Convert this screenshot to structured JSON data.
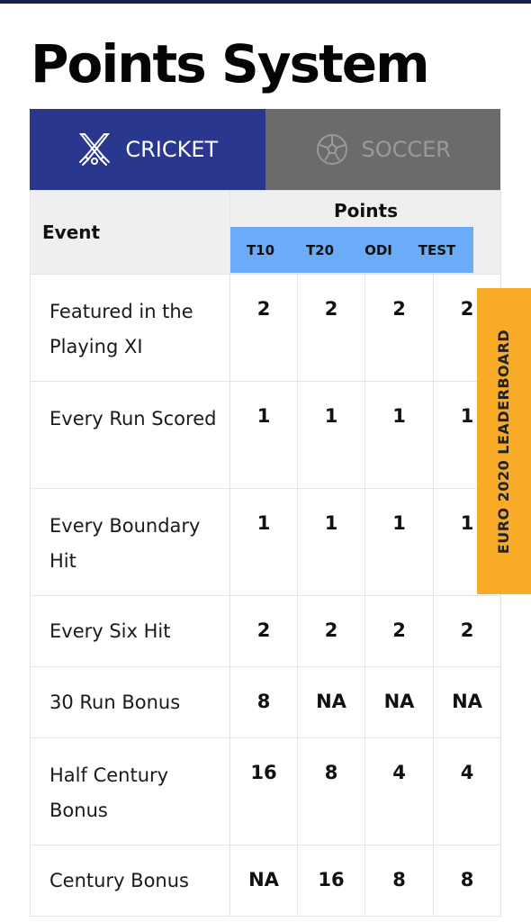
{
  "page": {
    "title": "Points System"
  },
  "tabs": [
    {
      "label": "CRICKET",
      "icon": "cricket-bats-icon",
      "active": true
    },
    {
      "label": "SOCCER",
      "icon": "soccer-ball-icon",
      "active": false
    }
  ],
  "table": {
    "event_header": "Event",
    "points_header": "Points",
    "formats": [
      "T10",
      "T20",
      "ODI",
      "TEST"
    ],
    "rows": [
      {
        "event": "Featured in the Playing XI",
        "values": [
          "2",
          "2",
          "2",
          "2"
        ]
      },
      {
        "event": "Every Run Scored",
        "values": [
          "1",
          "1",
          "1",
          "1"
        ]
      },
      {
        "event": "Every Boundary Hit",
        "values": [
          "1",
          "1",
          "1",
          "1"
        ]
      },
      {
        "event": "Every Six Hit",
        "values": [
          "2",
          "2",
          "2",
          "2"
        ]
      },
      {
        "event": "30 Run Bonus",
        "values": [
          "8",
          "NA",
          "NA",
          "NA"
        ]
      },
      {
        "event": "Half Century Bonus",
        "values": [
          "16",
          "8",
          "4",
          "4"
        ]
      },
      {
        "event": "Century Bonus",
        "values": [
          "NA",
          "16",
          "8",
          "8"
        ]
      }
    ]
  },
  "side_tab": {
    "label": "EURO 2020 LEADERBOARD"
  },
  "colors": {
    "cricket_tab": "#2a378f",
    "soccer_tab": "#6b6b6b",
    "format_bar": "#6aacf8",
    "leaderboard_tab": "#f7ab27",
    "top_bar": "#14204a"
  }
}
